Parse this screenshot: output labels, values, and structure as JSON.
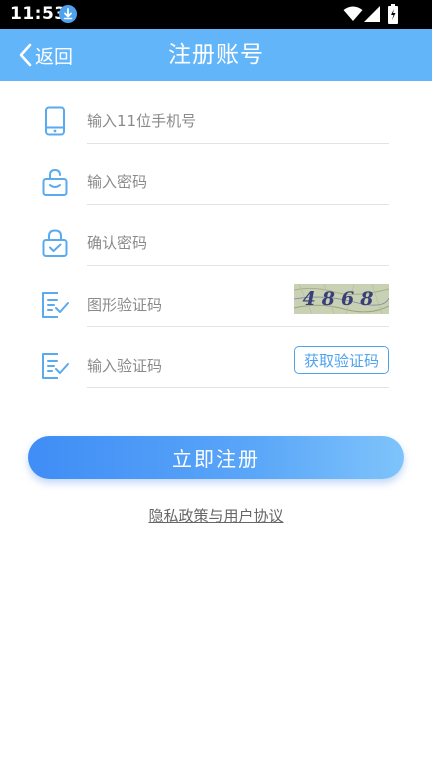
{
  "status_bar": {
    "time": "11:53",
    "icons": [
      "download-icon",
      "wifi-icon",
      "signal-icon",
      "battery-icon"
    ]
  },
  "nav": {
    "back_label": "返回",
    "title": "注册账号"
  },
  "form": {
    "phone": {
      "placeholder": "输入11位手机号",
      "icon": "phone-icon"
    },
    "password": {
      "placeholder": "输入密码",
      "icon": "lock-open-icon"
    },
    "confirm_password": {
      "placeholder": "确认密码",
      "icon": "lock-check-icon"
    },
    "captcha": {
      "placeholder": "图形验证码",
      "icon": "verify-icon",
      "captcha_text": "4868"
    },
    "sms_code": {
      "placeholder": "输入验证码",
      "icon": "verify-icon",
      "button_label": "获取验证码"
    }
  },
  "register_button": "立即注册",
  "policy_link": "隐私政策与用户协议",
  "colors": {
    "nav_bg": "#62b5f8",
    "accent": "#4ea3f0",
    "icon": "#5aaaf0",
    "button_start": "#3f8df6",
    "button_end": "#7ec4fb"
  }
}
